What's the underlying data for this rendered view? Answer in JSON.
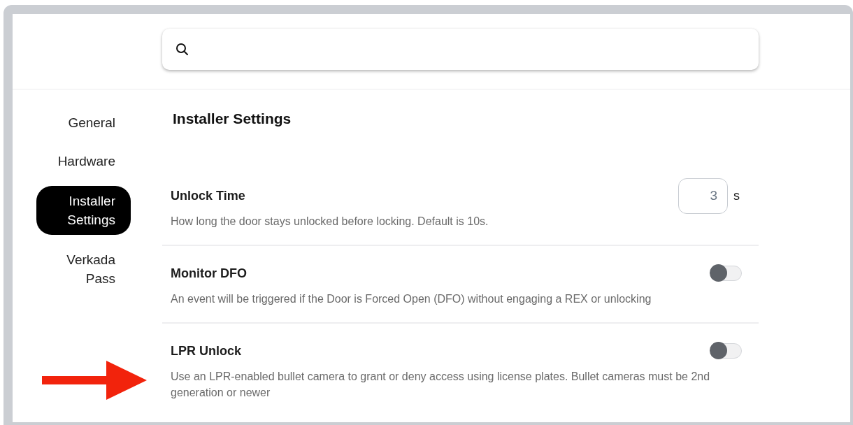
{
  "sidebar": {
    "items": [
      {
        "label": "General",
        "selected": false
      },
      {
        "label": "Hardware",
        "selected": false
      },
      {
        "label": "Installer Settings",
        "selected": true
      },
      {
        "label": "Verkada Pass",
        "selected": false
      }
    ]
  },
  "section_title": "Installer Settings",
  "settings": [
    {
      "kind": "number",
      "title": "Unlock Time",
      "value": "3",
      "unit": "s",
      "description": "How long the door stays unlocked before locking. Default is 10s."
    },
    {
      "kind": "toggle",
      "title": "Monitor DFO",
      "on": false,
      "description": "An event will be triggered if the Door is Forced Open (DFO) without engaging a REX or unlocking"
    },
    {
      "kind": "toggle",
      "title": "LPR Unlock",
      "on": false,
      "description": "Use an LPR-enabled bullet camera to grant or deny access using license plates. Bullet cameras must be 2nd generation or newer"
    }
  ]
}
